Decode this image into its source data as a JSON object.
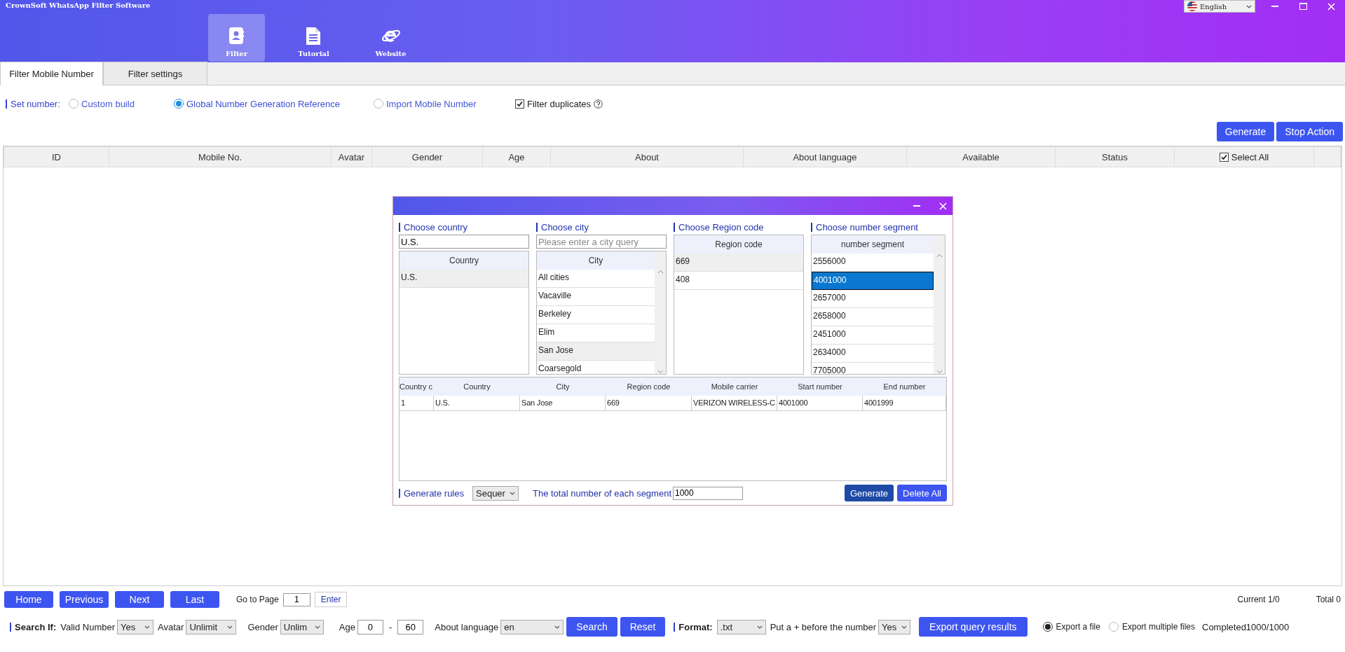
{
  "window": {
    "title": "CrownSoft WhatsApp Filter Software",
    "language": "English"
  },
  "nav": [
    {
      "label": "Filter",
      "kind": "contacts",
      "selected": true
    },
    {
      "label": "Tutorial",
      "kind": "document",
      "selected": false
    },
    {
      "label": "Website",
      "kind": "browser",
      "selected": false
    }
  ],
  "tabs": [
    {
      "label": "Filter Mobile Number",
      "selected": true
    },
    {
      "label": "Filter settings",
      "selected": false
    }
  ],
  "set_number": {
    "label": "Set number:",
    "options": [
      {
        "label": "Custom build",
        "selected": false
      },
      {
        "label": "Global Number Generation Reference",
        "selected": true
      },
      {
        "label": "Import Mobile Number",
        "selected": false
      }
    ],
    "filter_duplicates": {
      "label": "Filter duplicates",
      "checked": true
    }
  },
  "actions": [
    "Generate",
    "Stop Action"
  ],
  "table": {
    "columns": [
      "ID",
      "Mobile No.",
      "Avatar",
      "Gender",
      "Age",
      "About",
      "About language",
      "Available",
      "Status"
    ],
    "select_all": {
      "label": "Select All",
      "checked": true
    }
  },
  "dialog": {
    "lists": [
      {
        "label": "Choose country",
        "input": {
          "value": "U.S."
        },
        "column": "Country",
        "focused": false,
        "scroll": false,
        "rows": [
          {
            "text": "U.S.",
            "selected": true
          }
        ]
      },
      {
        "label": "Choose city",
        "input": {
          "placeholder": "Please enter a city query"
        },
        "column": "City",
        "focused": false,
        "scroll": true,
        "rows": [
          {
            "text": "All cities",
            "selected": false
          },
          {
            "text": "Vacaville",
            "selected": false
          },
          {
            "text": "Berkeley",
            "selected": false
          },
          {
            "text": "Elim",
            "selected": false
          },
          {
            "text": "San Jose",
            "selected": true
          },
          {
            "text": "Coarsegold",
            "selected": false
          }
        ]
      },
      {
        "label": "Choose Region code",
        "column": "Region code",
        "focused": false,
        "scroll": false,
        "rows": [
          {
            "text": "669",
            "selected": true
          },
          {
            "text": "408",
            "selected": false
          }
        ]
      },
      {
        "label": "Choose number segment",
        "column": "number segment",
        "focused": true,
        "scroll": true,
        "rows": [
          {
            "text": "2556000",
            "selected": false
          },
          {
            "text": "4001000",
            "selected": true
          },
          {
            "text": "2657000",
            "selected": false
          },
          {
            "text": "2658000",
            "selected": false
          },
          {
            "text": "2451000",
            "selected": false
          },
          {
            "text": "2634000",
            "selected": false
          },
          {
            "text": "7705000",
            "selected": false
          }
        ]
      }
    ],
    "results": {
      "columns": [
        "Country c",
        "Country",
        "City",
        "Region code",
        "Mobile carrier",
        "Start number",
        "End number"
      ],
      "rows": [
        [
          "1",
          "U.S.",
          "San Jose",
          "669",
          "VERIZON WIRELESS-C",
          "4001000",
          "4001999"
        ]
      ]
    },
    "rules_label": "Generate rules",
    "rules_value": "Sequer",
    "total_label": "The total number of each segment",
    "total_value": "1000",
    "buttons": [
      {
        "label": "Generate",
        "hovered": true
      },
      {
        "label": "Delete All",
        "hovered": false
      }
    ]
  },
  "pagination": {
    "buttons": [
      "Home",
      "Previous",
      "Next",
      "Last"
    ],
    "goto_label": "Go to Page",
    "page": "1",
    "enter": "Enter",
    "current": "Current 1/0",
    "total": "Total 0"
  },
  "search": {
    "label": "Search If:",
    "filters": [
      {
        "kind": "select",
        "label": "Valid Number",
        "value": "Yes"
      },
      {
        "kind": "select",
        "label": "Avatar",
        "value": "Unlimit"
      },
      {
        "kind": "select",
        "label": "Gender",
        "value": "Unlim"
      },
      {
        "kind": "range",
        "label": "Age",
        "from": "0",
        "separator": "-",
        "to": "60"
      },
      {
        "kind": "select",
        "label": "About language",
        "value": "en"
      }
    ],
    "buttons": [
      "Search",
      "Reset"
    ]
  },
  "export": {
    "label": "Format:",
    "format": ".txt",
    "plus_label": "Put a + before the number",
    "plus_value": "Yes",
    "button": "Export query results",
    "modes": [
      {
        "label": "Export a file",
        "selected": true
      },
      {
        "label": "Export multiple files",
        "selected": false
      }
    ],
    "status": "Completed1000/1000"
  }
}
